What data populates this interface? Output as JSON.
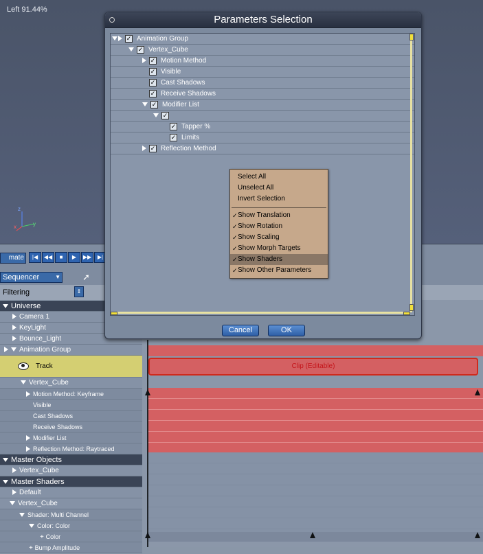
{
  "viewport": {
    "label": "Left 91.44%",
    "axes": {
      "z": "z",
      "y": "y",
      "x": "x"
    }
  },
  "toolbar": {
    "animate_label": "mate",
    "transport": [
      "|◀",
      "◀◀",
      "■",
      "▶",
      "▶▶",
      "▶|"
    ],
    "sequencer_select": "Sequencer",
    "filtering_label": "Filtering"
  },
  "tree": {
    "universe": "Universe",
    "camera1": "Camera 1",
    "keylight": "KeyLight",
    "bounce_light": "Bounce_Light",
    "animation_group": "Animation Group",
    "track": "Track",
    "vertex_cube": "Vertex_Cube",
    "motion_method": "Motion Method: Keyframe",
    "visible": "Visible",
    "cast_shadows": "Cast Shadows",
    "receive_shadows": "Receive Shadows",
    "modifier_list": "Modifier List",
    "reflection_method": "Reflection Method: Raytraced",
    "master_objects": "Master Objects",
    "mo_vertex_cube": "Vertex_Cube",
    "master_shaders": "Master Shaders",
    "default": "Default",
    "ms_vertex_cube": "Vertex_Cube",
    "shader_multi": "Shader: Multi Channel",
    "color_color": "Color: Color",
    "color": "Color",
    "bump": "Bump Amplitude"
  },
  "timeline": {
    "clip_label": "Clip (Editable)"
  },
  "dialog": {
    "title": "Parameters Selection",
    "params": {
      "animation_group": "Animation Group",
      "vertex_cube": "Vertex_Cube",
      "motion_method": "Motion Method",
      "visible": "Visible",
      "cast_shadows": "Cast Shadows",
      "receive_shadows": "Receive Shadows",
      "modifier_list": "Modifier List",
      "tapper": "Tapper %",
      "limits": "Limits",
      "reflection_method": "Reflection Method"
    },
    "menu": {
      "select_all": "Select All",
      "unselect_all": "Unselect All",
      "invert_selection": "Invert Selection",
      "show_translation": "Show Translation",
      "show_rotation": "Show Rotation",
      "show_scaling": "Show Scaling",
      "show_morph": "Show Morph Targets",
      "show_shaders": "Show Shaders",
      "show_other": "Show Other Parameters",
      "check": "✓"
    },
    "cancel": "Cancel",
    "ok": "OK"
  },
  "colors": {
    "track_highlight": "#d4cf72",
    "timeline_red": "#d46062",
    "button_blue": "#2f64b0"
  }
}
